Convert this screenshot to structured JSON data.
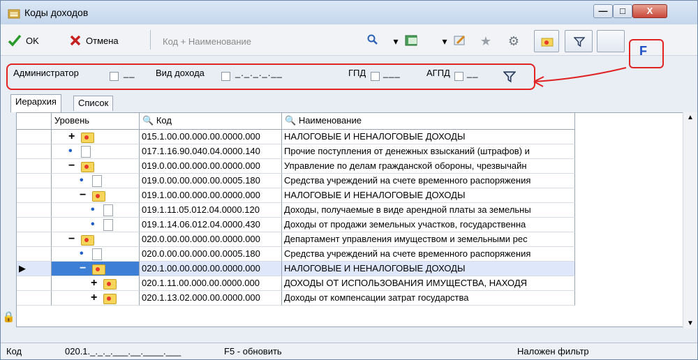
{
  "window": {
    "title": "Коды доходов"
  },
  "toolbar": {
    "ok_label": "OK",
    "cancel_label": "Отмена",
    "search_placeholder": "Код + Наименование",
    "f_label": "F"
  },
  "filters": {
    "administrator_label": "Администратор",
    "administrator_value": "__",
    "income_type_label": "Вид дохода",
    "income_type_value": "_._._._.__",
    "gpd_label": "ГПД",
    "gpd_value": "___",
    "agpd_label": "АГПД",
    "agpd_value": "__"
  },
  "tabs": [
    {
      "label": "Иерархия",
      "active": true
    },
    {
      "label": "Список",
      "active": false
    }
  ],
  "grid": {
    "columns": [
      "Уровень",
      "Код",
      "Наименование"
    ],
    "rows": [
      {
        "mark": "+",
        "icon": "folder",
        "code": "015.1.00.00.000.00.0000.000",
        "name": "НАЛОГОВЫЕ И НЕНАЛОГОВЫЕ ДОХОДЫ",
        "indent": 1
      },
      {
        "mark": "•",
        "icon": "doc",
        "code": "017.1.16.90.040.04.0000.140",
        "name": "Прочие поступления от денежных взысканий (штрафов) и",
        "indent": 1
      },
      {
        "mark": "−",
        "icon": "folder-open",
        "code": "019.0.00.00.000.00.0000.000",
        "name": "Управление по делам гражданской обороны, чрезвычайн",
        "indent": 1
      },
      {
        "mark": "•",
        "icon": "doc",
        "code": "019.0.00.00.000.00.0005.180",
        "name": "Средства учреждений на счете временного распоряжения",
        "indent": 2
      },
      {
        "mark": "−",
        "icon": "folder-open",
        "code": "019.1.00.00.000.00.0000.000",
        "name": "НАЛОГОВЫЕ И НЕНАЛОГОВЫЕ ДОХОДЫ",
        "indent": 2
      },
      {
        "mark": "•",
        "icon": "doc",
        "code": "019.1.11.05.012.04.0000.120",
        "name": "Доходы, получаемые в виде арендной платы за земельны",
        "indent": 3
      },
      {
        "mark": "•",
        "icon": "doc",
        "code": "019.1.14.06.012.04.0000.430",
        "name": "Доходы от продажи земельных участков, государственна",
        "indent": 3
      },
      {
        "mark": "−",
        "icon": "folder-open",
        "code": "020.0.00.00.000.00.0000.000",
        "name": "Департамент управления имуществом и земельными рес",
        "indent": 1
      },
      {
        "mark": "•",
        "icon": "doc",
        "code": "020.0.00.00.000.00.0005.180",
        "name": "Средства учреждений на счете временного распоряжения",
        "indent": 2
      },
      {
        "mark": "−",
        "icon": "folder-open",
        "code": "020.1.00.00.000.00.0000.000",
        "name": "НАЛОГОВЫЕ И НЕНАЛОГОВЫЕ ДОХОДЫ",
        "indent": 2,
        "selected": true
      },
      {
        "mark": "+",
        "icon": "folder",
        "code": "020.1.11.00.000.00.0000.000",
        "name": "ДОХОДЫ ОТ ИСПОЛЬЗОВАНИЯ ИМУЩЕСТВА, НАХОДЯ",
        "indent": 3
      },
      {
        "mark": "+",
        "icon": "folder",
        "code": "020.1.13.02.000.00.0000.000",
        "name": "Доходы от компенсации затрат государства",
        "indent": 3
      }
    ]
  },
  "status": {
    "code_label": "Код",
    "code_value": "020.1._._._.___.__.____.___",
    "refresh_hint": "F5 - обновить",
    "filter_state": "Наложен фильтр"
  },
  "colors": {
    "highlight": "#e02424",
    "selection": "#3d7fd6",
    "f_text": "#1f4fc7"
  }
}
